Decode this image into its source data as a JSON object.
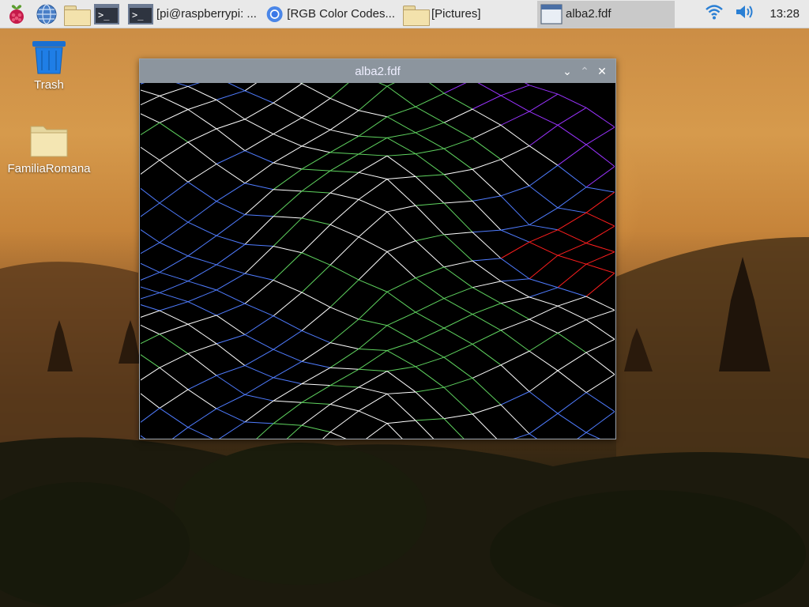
{
  "taskbar": {
    "tasks": [
      {
        "label": "[pi@raspberrypi: ...",
        "icon": "terminal-icon"
      },
      {
        "label": "[RGB Color Codes...",
        "icon": "chromium-icon"
      },
      {
        "label": "[Pictures]",
        "icon": "folder-icon"
      },
      {
        "label": "alba2.fdf",
        "icon": "window-icon"
      }
    ],
    "clock": "13:28"
  },
  "desktop": {
    "icons": [
      {
        "label": "Trash",
        "icon": "trash-icon"
      },
      {
        "label": "FamiliaRomana",
        "icon": "folder-icon"
      }
    ]
  },
  "window": {
    "title": "alba2.fdf",
    "minimize": "⌄",
    "maximize": "⌃",
    "close": "✕"
  },
  "colors": {
    "white": "#ffffff",
    "green": "#5fd35f",
    "blue": "#4f7cff",
    "purple": "#9a33ff",
    "red": "#ff1e1e"
  }
}
